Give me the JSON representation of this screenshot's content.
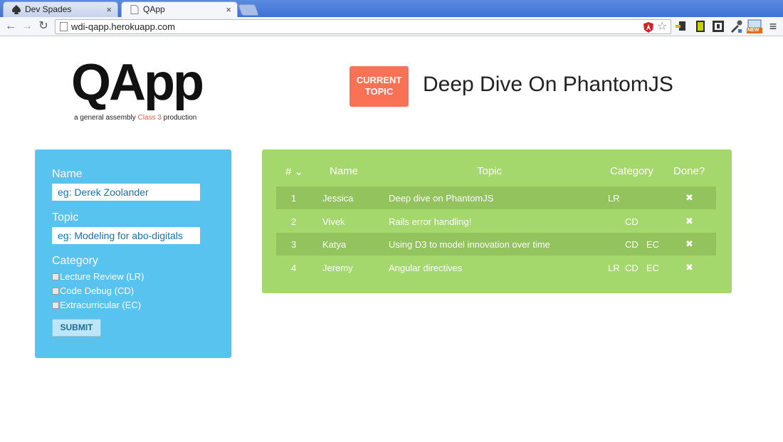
{
  "browser": {
    "tabs": [
      {
        "title": "Dev Spades",
        "close": "×"
      },
      {
        "title": "QApp",
        "close": "×"
      }
    ],
    "nav": {
      "back": "←",
      "forward": "→",
      "reload": "↻",
      "menu": "≡"
    },
    "url": "wdi-qapp.herokuapp.com",
    "star": "☆",
    "extension_badge": "NEW"
  },
  "header": {
    "logo": "QApp",
    "tagline_before": "a general assembly ",
    "tagline_accent": "Class 3",
    "tagline_after": " production",
    "current_topic_label_line1": "CURRENT",
    "current_topic_label_line2": "TOPIC",
    "current_topic": "Deep Dive On PhantomJS"
  },
  "form": {
    "name_label": "Name",
    "name_placeholder": "eg: Derek Zoolander",
    "topic_label": "Topic",
    "topic_placeholder": "eg: Modeling for abo-digitals",
    "category_label": "Category",
    "categories": [
      "Lecture Review (LR)",
      "Code Debug (CD)",
      "Extracurricular (EC)"
    ],
    "submit_label": "SUBMIT"
  },
  "table": {
    "headers": {
      "number": "# ⌄",
      "name": "Name",
      "topic": "Topic",
      "category": "Category",
      "done": "Done?"
    },
    "rows": [
      {
        "num": "1",
        "name": "Jessica",
        "topic": "Deep dive on PhantomJS",
        "lr": "LR",
        "cd": "",
        "ec": "",
        "done": "✖"
      },
      {
        "num": "2",
        "name": "Vivek",
        "topic": "Rails error handling!",
        "lr": "",
        "cd": "CD",
        "ec": "",
        "done": "✖"
      },
      {
        "num": "3",
        "name": "Katya",
        "topic": "Using D3 to model innovation over time",
        "lr": "",
        "cd": "CD",
        "ec": "EC",
        "done": "✖"
      },
      {
        "num": "4",
        "name": "Jeremy",
        "topic": "Angular directives",
        "lr": "LR",
        "cd": "CD",
        "ec": "EC",
        "done": "✖"
      }
    ]
  },
  "colors": {
    "form_panel": "#58c3ee",
    "table_panel": "#a5d86c",
    "table_row_shade": "#92c35c",
    "current_topic_badge": "#f97256",
    "accent_text": "#e8624a"
  }
}
